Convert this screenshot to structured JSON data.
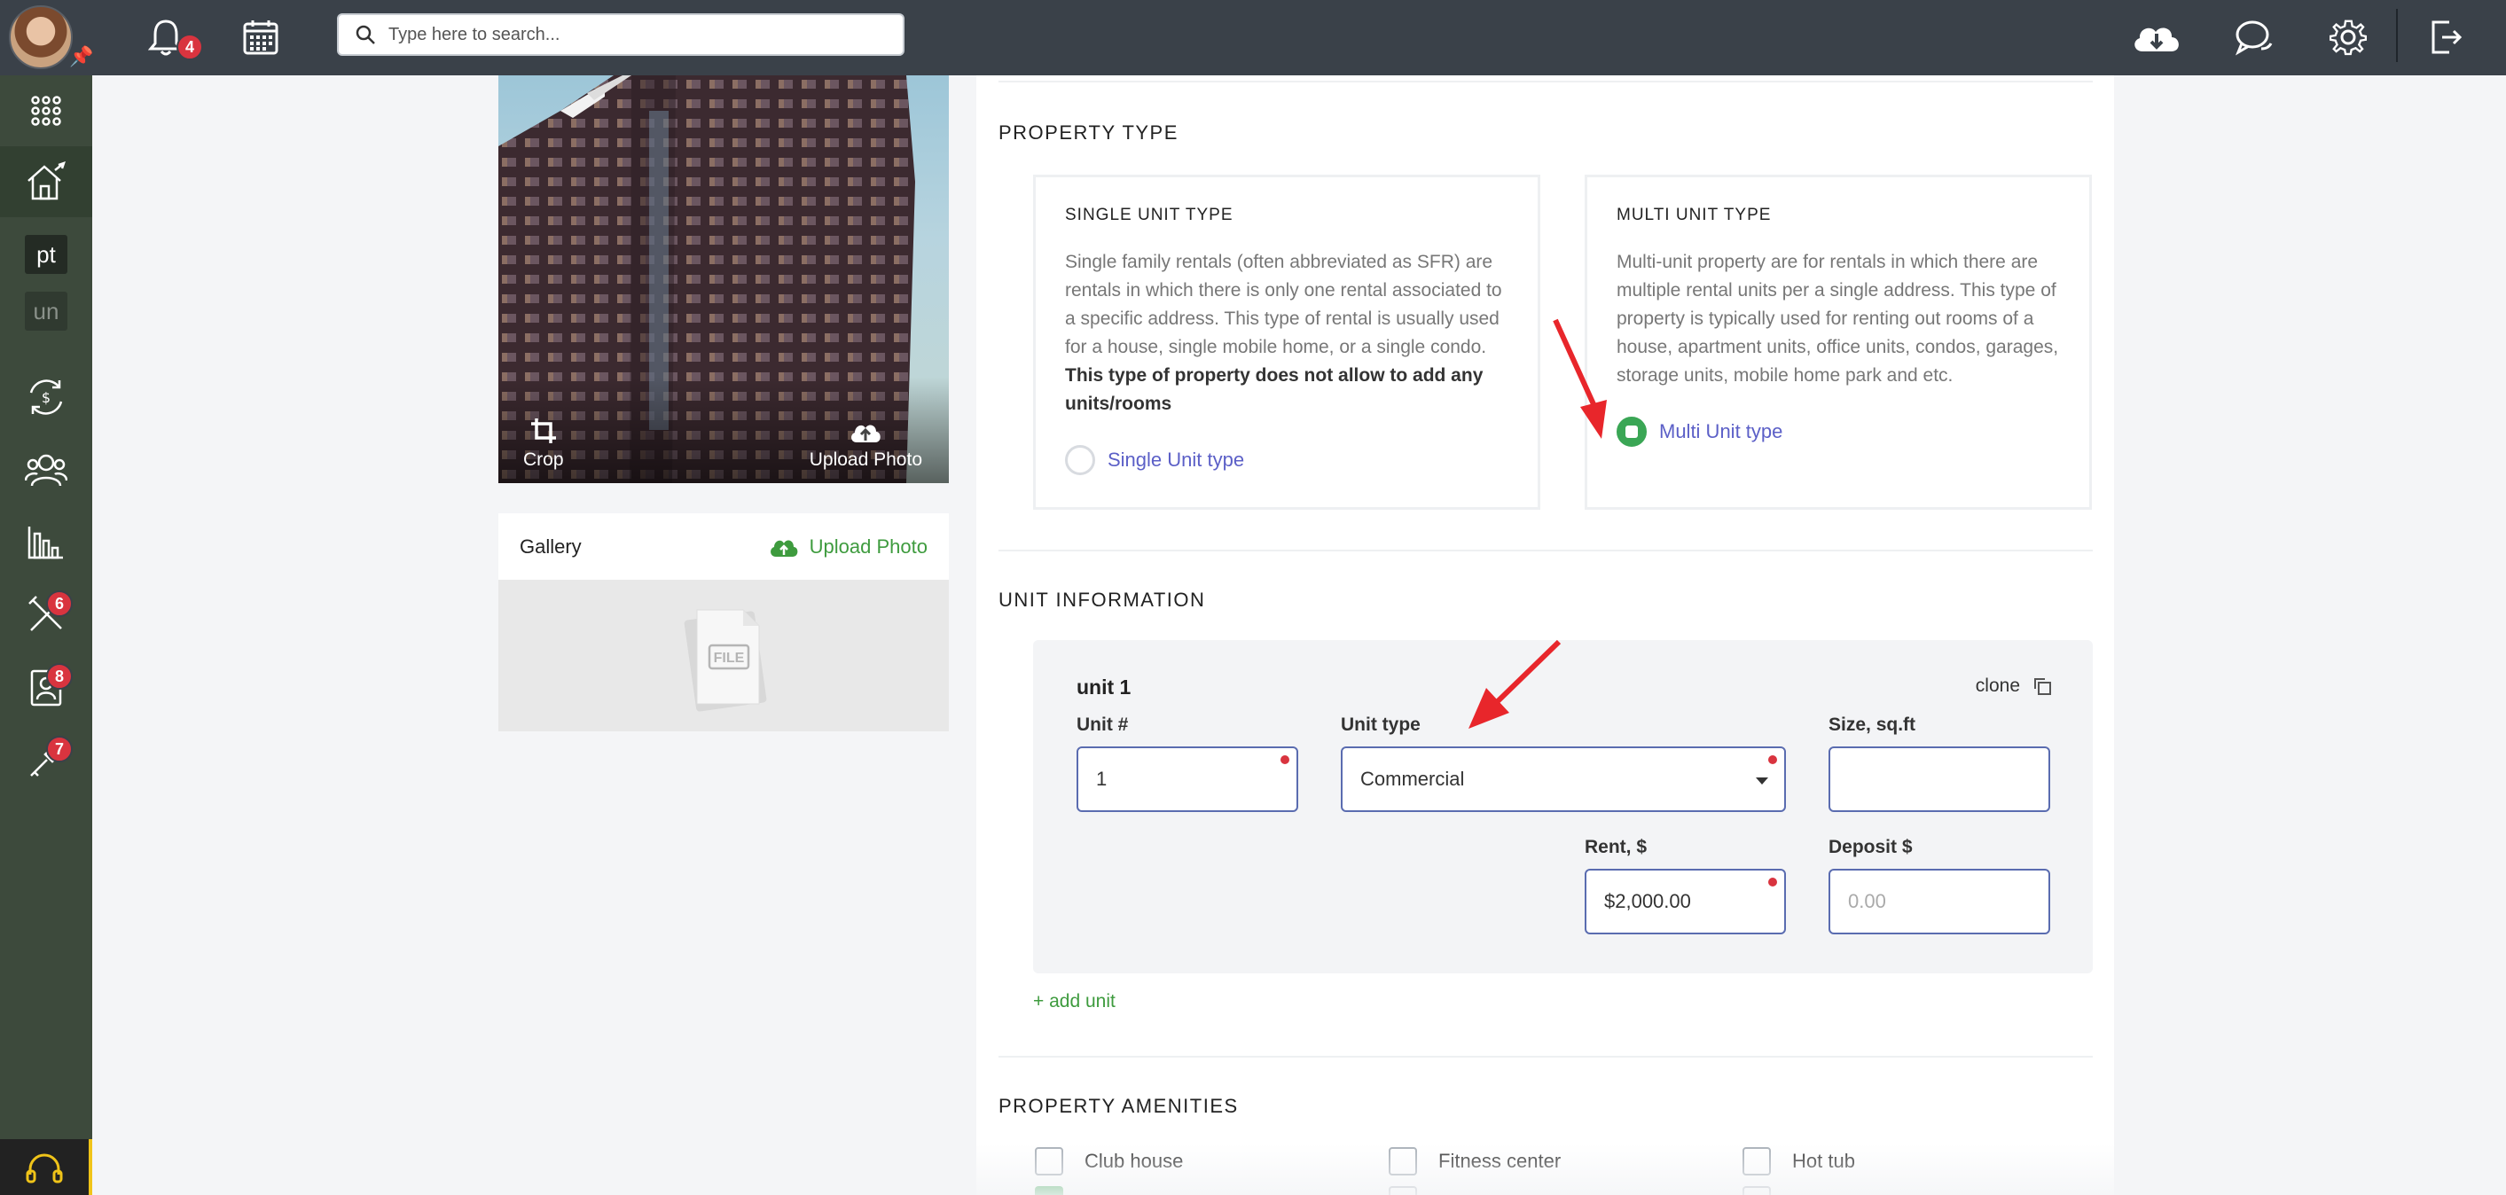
{
  "topbar": {
    "notification_count": "4",
    "search_placeholder": "Type here to search..."
  },
  "sidebar": {
    "items": [
      {
        "icon": "apps-grid-icon"
      },
      {
        "icon": "property-house-icon",
        "active": true
      },
      {
        "text": "pt"
      },
      {
        "text": "un"
      },
      {
        "icon": "payments-cycle-icon"
      },
      {
        "icon": "people-icon"
      },
      {
        "icon": "reports-chart-icon"
      },
      {
        "icon": "maintenance-tools-icon",
        "badge": "6"
      },
      {
        "icon": "contacts-icon",
        "badge": "8"
      },
      {
        "icon": "service-key-icon",
        "badge": "7"
      }
    ]
  },
  "photo": {
    "crop_label": "Crop",
    "upload_label": "Upload Photo"
  },
  "gallery": {
    "title": "Gallery",
    "upload_label": "Upload Photo",
    "file_label": "FILE"
  },
  "property_type": {
    "section_title": "PROPERTY TYPE",
    "single": {
      "heading": "SINGLE UNIT TYPE",
      "description": "Single family rentals (often abbreviated as SFR) are rentals in which there is only one rental associated to a specific address. This type of rental is usually used for a house, single mobile home, or a single condo.",
      "description_bold": "This type of property does not allow to add any units/rooms",
      "option_label": "Single Unit type",
      "selected": false
    },
    "multi": {
      "heading": "MULTI UNIT TYPE",
      "description": "Multi-unit property are for rentals in which there are multiple rental units per a single address. This type of property is typically used for renting out rooms of a house, apartment units, office units, condos, garages, storage units, mobile home park and etc.",
      "option_label": "Multi Unit type",
      "selected": true
    }
  },
  "unit_information": {
    "section_title": "UNIT INFORMATION",
    "unit_title": "unit 1",
    "clone_label": "clone",
    "fields": {
      "unit_number": {
        "label": "Unit #",
        "value": "1"
      },
      "unit_type": {
        "label": "Unit type",
        "value": "Commercial"
      },
      "size": {
        "label": "Size, sq.ft",
        "value": ""
      },
      "rent": {
        "label": "Rent, $",
        "value": "$2,000.00"
      },
      "deposit": {
        "label": "Deposit $",
        "placeholder": "0.00"
      }
    },
    "add_unit_label": "+ add unit"
  },
  "amenities": {
    "section_title": "PROPERTY AMENITIES",
    "items": [
      {
        "label": "Club house",
        "checked": false
      },
      {
        "label": "Fitness center",
        "checked": false
      },
      {
        "label": "Hot tub",
        "checked": false
      }
    ],
    "next_row": [
      {
        "checked": true
      },
      {
        "checked": false
      },
      {
        "checked": false
      }
    ]
  },
  "colors": {
    "topbar": "#3a4149",
    "sidebar": "#3d4a3c",
    "accent_green": "#3aa655",
    "link_purple": "#5b5fc7",
    "badge_red": "#d9343f",
    "arrow_red": "#e8262b"
  }
}
